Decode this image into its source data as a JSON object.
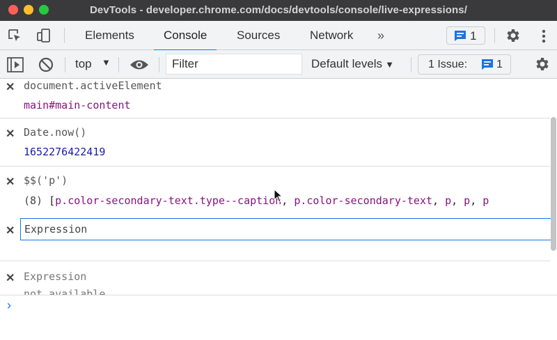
{
  "window": {
    "title": "DevTools - developer.chrome.com/docs/devtools/console/live-expressions/"
  },
  "tabs": [
    {
      "label": "Elements"
    },
    {
      "label": "Console",
      "active": true
    },
    {
      "label": "Sources"
    },
    {
      "label": "Network"
    }
  ],
  "tabbar": {
    "more_tabs": "»",
    "issue_count": "1"
  },
  "console_toolbar": {
    "context": "top",
    "context_caret": "▼",
    "filter_placeholder": "Filter",
    "levels": "Default levels",
    "levels_caret": "▼",
    "issues_label": "1 Issue:",
    "issues_count": "1"
  },
  "live_expressions": [
    {
      "expression": "document.activeElement",
      "value": "main#main-content"
    },
    {
      "expression": "Date.now()",
      "value": "1652276422419"
    },
    {
      "expression": "$$('p')",
      "value_count": "(8)",
      "value_open": "[",
      "value_items": [
        "p.color-secondary-text.type--caption",
        "p.color-secondary-text",
        "p",
        "p",
        "p"
      ],
      "value_sep": ", "
    },
    {
      "editing_placeholder": "Expression"
    },
    {
      "expression": "Expression",
      "value": "not available"
    }
  ],
  "prompt": {
    "chevron": "›"
  },
  "colors": {
    "accent": "#1a73e8",
    "title_bar": "#3a3a3c",
    "element_purple": "#881280",
    "number_blue": "#1a1aa6"
  },
  "icons": [
    "inspect-element-icon",
    "device-toolbar-icon",
    "message-icon",
    "gear-icon",
    "more-icon",
    "sidebar-toggle-icon",
    "clear-console-icon",
    "eye-icon",
    "close-icon",
    "mouse-pointer-icon"
  ]
}
